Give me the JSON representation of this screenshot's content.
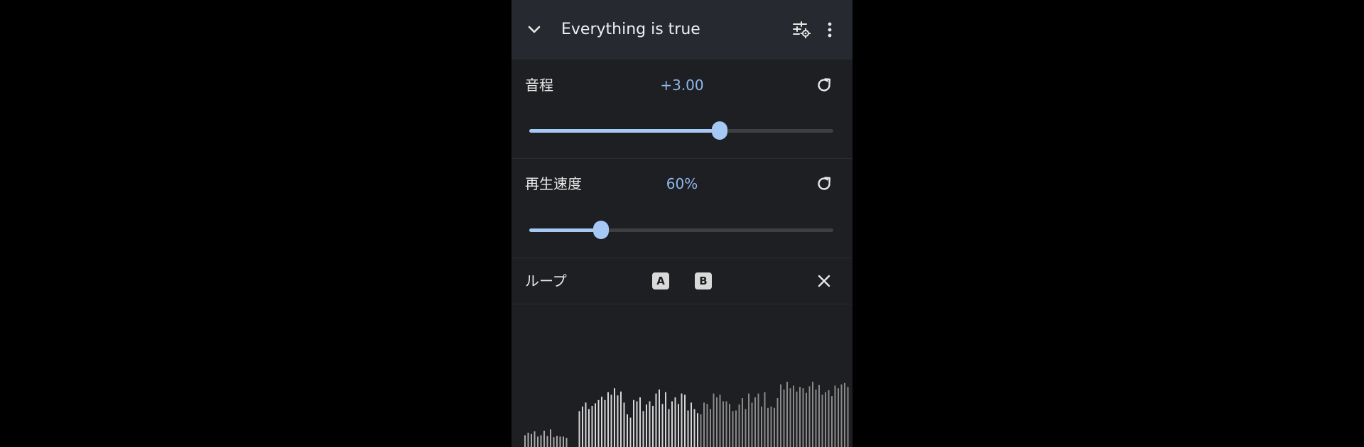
{
  "header": {
    "title": "Everything is true",
    "icons": [
      "chevron-down-icon",
      "equalizer-settings-icon",
      "more-vert-icon"
    ]
  },
  "pitch": {
    "label": "音程",
    "value_text": "+3.00",
    "level": 0.625,
    "reset_icon": "refresh-icon"
  },
  "speed": {
    "label": "再生速度",
    "value_text": "60%",
    "level": 0.235,
    "reset_icon": "refresh-icon"
  },
  "loop": {
    "label": "ループ",
    "point_a": "A",
    "point_b": "B",
    "clear_icon": "close-icon"
  },
  "waveform": {
    "bar_heights": [
      0.18,
      0.22,
      0.2,
      0.24,
      0.16,
      0.18,
      0.25,
      0.17,
      0.27,
      0.15,
      0.17,
      0.16,
      0.16,
      0.14,
      0,
      0,
      0,
      0.55,
      0.62,
      0.68,
      0.58,
      0.63,
      0.67,
      0.72,
      0.77,
      0.72,
      0.84,
      0.8,
      0.9,
      0.79,
      0.85,
      0.68,
      0.5,
      0.45,
      0.72,
      0.7,
      0.76,
      0.55,
      0.65,
      0.7,
      0.63,
      0.82,
      0.88,
      0.66,
      0.84,
      0.58,
      0.7,
      0.76,
      0.66,
      0.82,
      0.8,
      0.56,
      0.68,
      0.58,
      0.52,
      0.5,
      0.68,
      0.66,
      0.58,
      0.82,
      0.76,
      0.8,
      0.7,
      0.7,
      0.66,
      0.55,
      0.56,
      0.65,
      0.75,
      0.58,
      0.82,
      0.68,
      0.76,
      0.82,
      0.62,
      0.84,
      0.6,
      0.62,
      0.6,
      0.75,
      0.96,
      0.88,
      1.0,
      0.9,
      0.94,
      0.85,
      0.92,
      0.9,
      0.83,
      0.93,
      1.0,
      0.88,
      0.95,
      0.8,
      0.84,
      0.87,
      0.78,
      0.94,
      0.9,
      0.96,
      0.98,
      0.92
    ],
    "colors": {
      "active": "#d6d6d6",
      "inactive": "#8a8a8a",
      "dim": "#aaaaaa"
    }
  },
  "colors": {
    "accent": "#a5c8f4",
    "header_bg": "#26292f",
    "panel_bg": "#1e1f22"
  }
}
